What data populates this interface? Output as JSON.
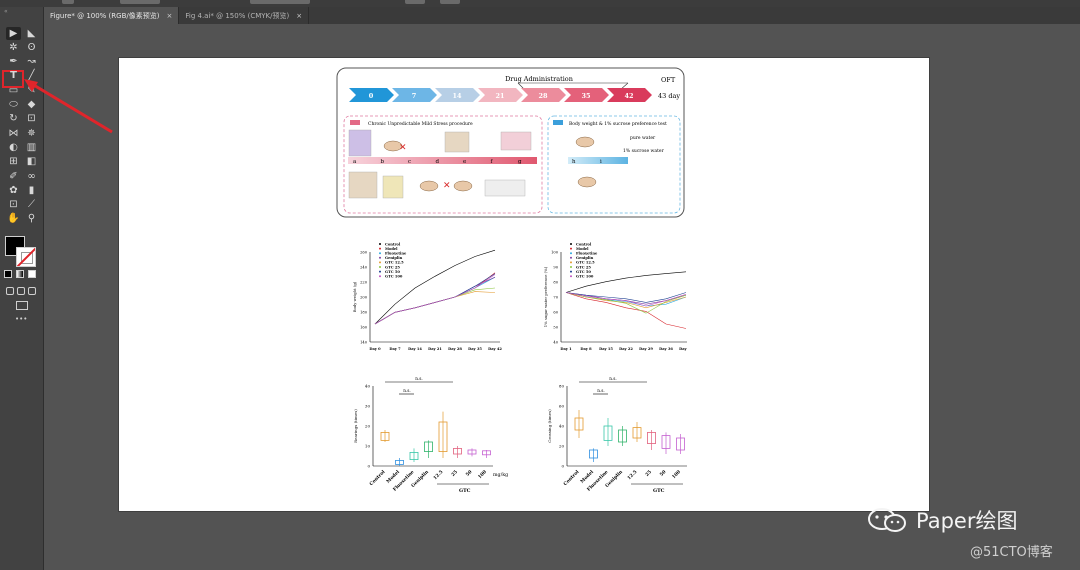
{
  "tabs": [
    {
      "label": "Figure* @ 100% (RGB/像素预览)",
      "close": "×",
      "active": true
    },
    {
      "label": "Fig 4.ai* @ 150% (CMYK/预览)",
      "close": "×",
      "active": false
    }
  ],
  "toolbar": {
    "grip": "«",
    "tools": [
      {
        "name": "selection-tool-icon"
      },
      {
        "name": "direct-selection-tool-icon"
      },
      {
        "name": "magic-wand-tool-icon"
      },
      {
        "name": "lasso-tool-icon"
      },
      {
        "name": "pen-tool-icon"
      },
      {
        "name": "curvature-tool-icon"
      },
      {
        "name": "type-tool-icon"
      },
      {
        "name": "line-segment-tool-icon"
      },
      {
        "name": "rectangle-tool-icon"
      },
      {
        "name": "paintbrush-tool-icon"
      },
      {
        "name": "shaper-tool-icon"
      },
      {
        "name": "eraser-tool-icon"
      },
      {
        "name": "rotate-tool-icon"
      },
      {
        "name": "scale-tool-icon"
      },
      {
        "name": "width-tool-icon"
      },
      {
        "name": "puppet-warp-tool-icon"
      },
      {
        "name": "shape-builder-tool-icon"
      },
      {
        "name": "perspective-grid-tool-icon"
      },
      {
        "name": "mesh-tool-icon"
      },
      {
        "name": "gradient-tool-icon"
      },
      {
        "name": "eyedropper-tool-icon"
      },
      {
        "name": "blend-tool-icon"
      },
      {
        "name": "symbol-sprayer-tool-icon"
      },
      {
        "name": "column-graph-tool-icon"
      },
      {
        "name": "artboard-tool-icon"
      },
      {
        "name": "slice-tool-icon"
      },
      {
        "name": "hand-tool-icon"
      },
      {
        "name": "zoom-tool-icon"
      }
    ],
    "more": "•••"
  },
  "figure": {
    "header": {
      "title": "Drug Administration",
      "oft": "OFT",
      "end_day": "43 day",
      "days": [
        "0",
        "7",
        "14",
        "21",
        "28",
        "35",
        "42"
      ]
    },
    "cums": {
      "title": "Chronic Unpredictable Mild Stress procedure",
      "letters": [
        "a",
        "b",
        "c",
        "d",
        "e",
        "f",
        "g"
      ]
    },
    "sucrose": {
      "title": "Body weight & 1% sucrose preference test",
      "pure": "pure water",
      "sucrose": "1% sucrose water",
      "letters": [
        "h",
        "i"
      ]
    },
    "legend": [
      "Control",
      "Model",
      "Fluoxetine",
      "Geniplin",
      "GTC 12.5",
      "GTC 25",
      "GTC 50",
      "GTC 100"
    ],
    "colors": {
      "Control": "#000000",
      "Model": "#d8232a",
      "Fluoxetine": "#2aa9e0",
      "Geniplin": "#7d3fa0",
      "GTC 12.5": "#e39a2e",
      "GTC 25": "#8cc63f",
      "GTC 50": "#1d3f91",
      "GTC 100": "#c04fbf"
    },
    "bw_chart": {
      "ylabel": "Body weight (g)",
      "yticks": [
        "260",
        "240",
        "220",
        "200",
        "180",
        "160",
        "140"
      ],
      "xticks": [
        "Day 0",
        "Day 7",
        "Day 14",
        "Day 21",
        "Day 28",
        "Day 35",
        "Day 42"
      ]
    },
    "sp_chart": {
      "ylabel": "1% sugar water preference (%)",
      "yticks": [
        "100",
        "90",
        "80",
        "70",
        "60",
        "50",
        "40"
      ],
      "xticks": [
        "Day 1",
        "Day 8",
        "Day 15",
        "Day 22",
        "Day 29",
        "Day 36",
        "Day 43"
      ]
    },
    "rear_chart": {
      "ylabel": "Rearings (times)",
      "yticks": [
        "40",
        "30",
        "20",
        "10",
        "0"
      ],
      "xticks": [
        "Control",
        "Model",
        "Fluoxetine",
        "Geniplin",
        "12.5",
        "25",
        "50",
        "100"
      ],
      "ns1": "n.s.",
      "ns2": "n.s.",
      "gtc": "GTC",
      "unit": "mg/kg"
    },
    "cross_chart": {
      "ylabel": "Crossing (times)",
      "yticks": [
        "80",
        "60",
        "40",
        "20",
        "0"
      ],
      "xticks": [
        "Control",
        "Model",
        "Fluoxetine",
        "Geniplin",
        "12.5",
        "25",
        "50",
        "100"
      ],
      "ns1": "n.s.",
      "ns2": "n.s.",
      "gtc": "GTC",
      "unit": "mg/kg"
    }
  },
  "watermark": {
    "text": "Paper绘图",
    "credit": "@51CTO博客"
  }
}
